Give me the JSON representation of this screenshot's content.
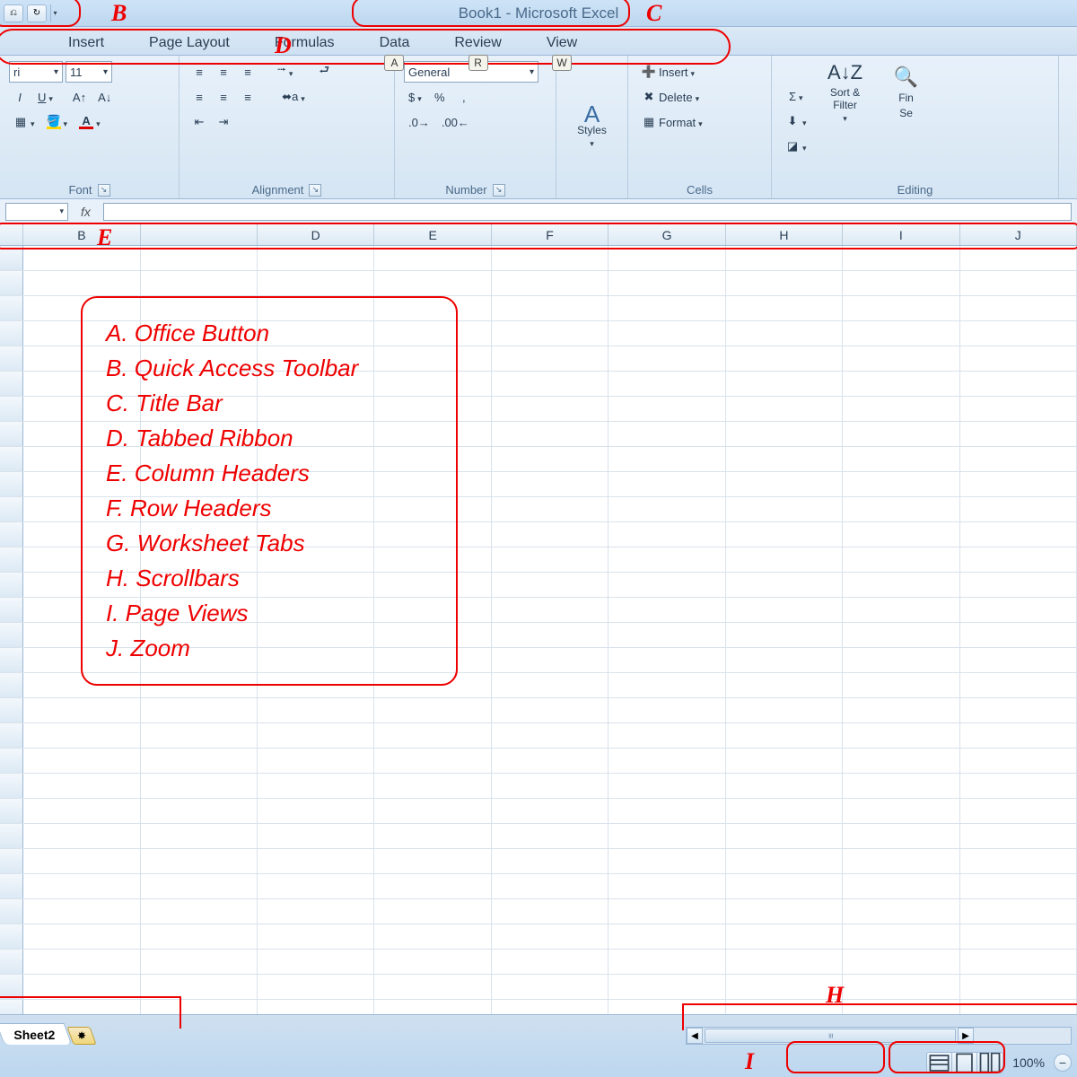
{
  "title": "Book1 - Microsoft Excel",
  "tabs": [
    "Insert",
    "Page Layout",
    "Formulas",
    "Data",
    "Review",
    "View"
  ],
  "keytips": {
    "data": "A",
    "review": "R",
    "view": "W"
  },
  "font": {
    "name": "Calibri",
    "name_visible": "ri",
    "size": "11",
    "group": "Font"
  },
  "alignment": {
    "group": "Alignment"
  },
  "number": {
    "format": "General",
    "group": "Number",
    "currency": "$",
    "percent": "%",
    "comma": ",",
    "inc": ".0",
    "dec": ".00"
  },
  "styles": {
    "label": "Styles"
  },
  "cells": {
    "insert": "Insert",
    "delete": "Delete",
    "format": "Format",
    "group": "Cells"
  },
  "editing": {
    "sum": "Σ",
    "sort": "Sort & Filter",
    "find_partial": "Find & Select",
    "find_vis": "Fin",
    "sel_vis": "Se",
    "group": "Editing"
  },
  "fx_label": "fx",
  "columns": [
    "",
    "B",
    "",
    "D",
    "E",
    "F",
    "G",
    "H",
    "I",
    "J"
  ],
  "legend": [
    "A.  Office Button",
    "B.  Quick Access Toolbar",
    "C.  Title Bar",
    "D.  Tabbed Ribbon",
    "E.  Column Headers",
    "F.  Row Headers",
    "G.  Worksheet Tabs",
    "H.  Scrollbars",
    "I.  Page Views",
    "J.  Zoom"
  ],
  "sheet_tabs": {
    "active": "Sheet2"
  },
  "zoom": "100%",
  "labels": {
    "B": "B",
    "C": "C",
    "D": "D",
    "E": "E",
    "H": "H",
    "I": "I"
  }
}
